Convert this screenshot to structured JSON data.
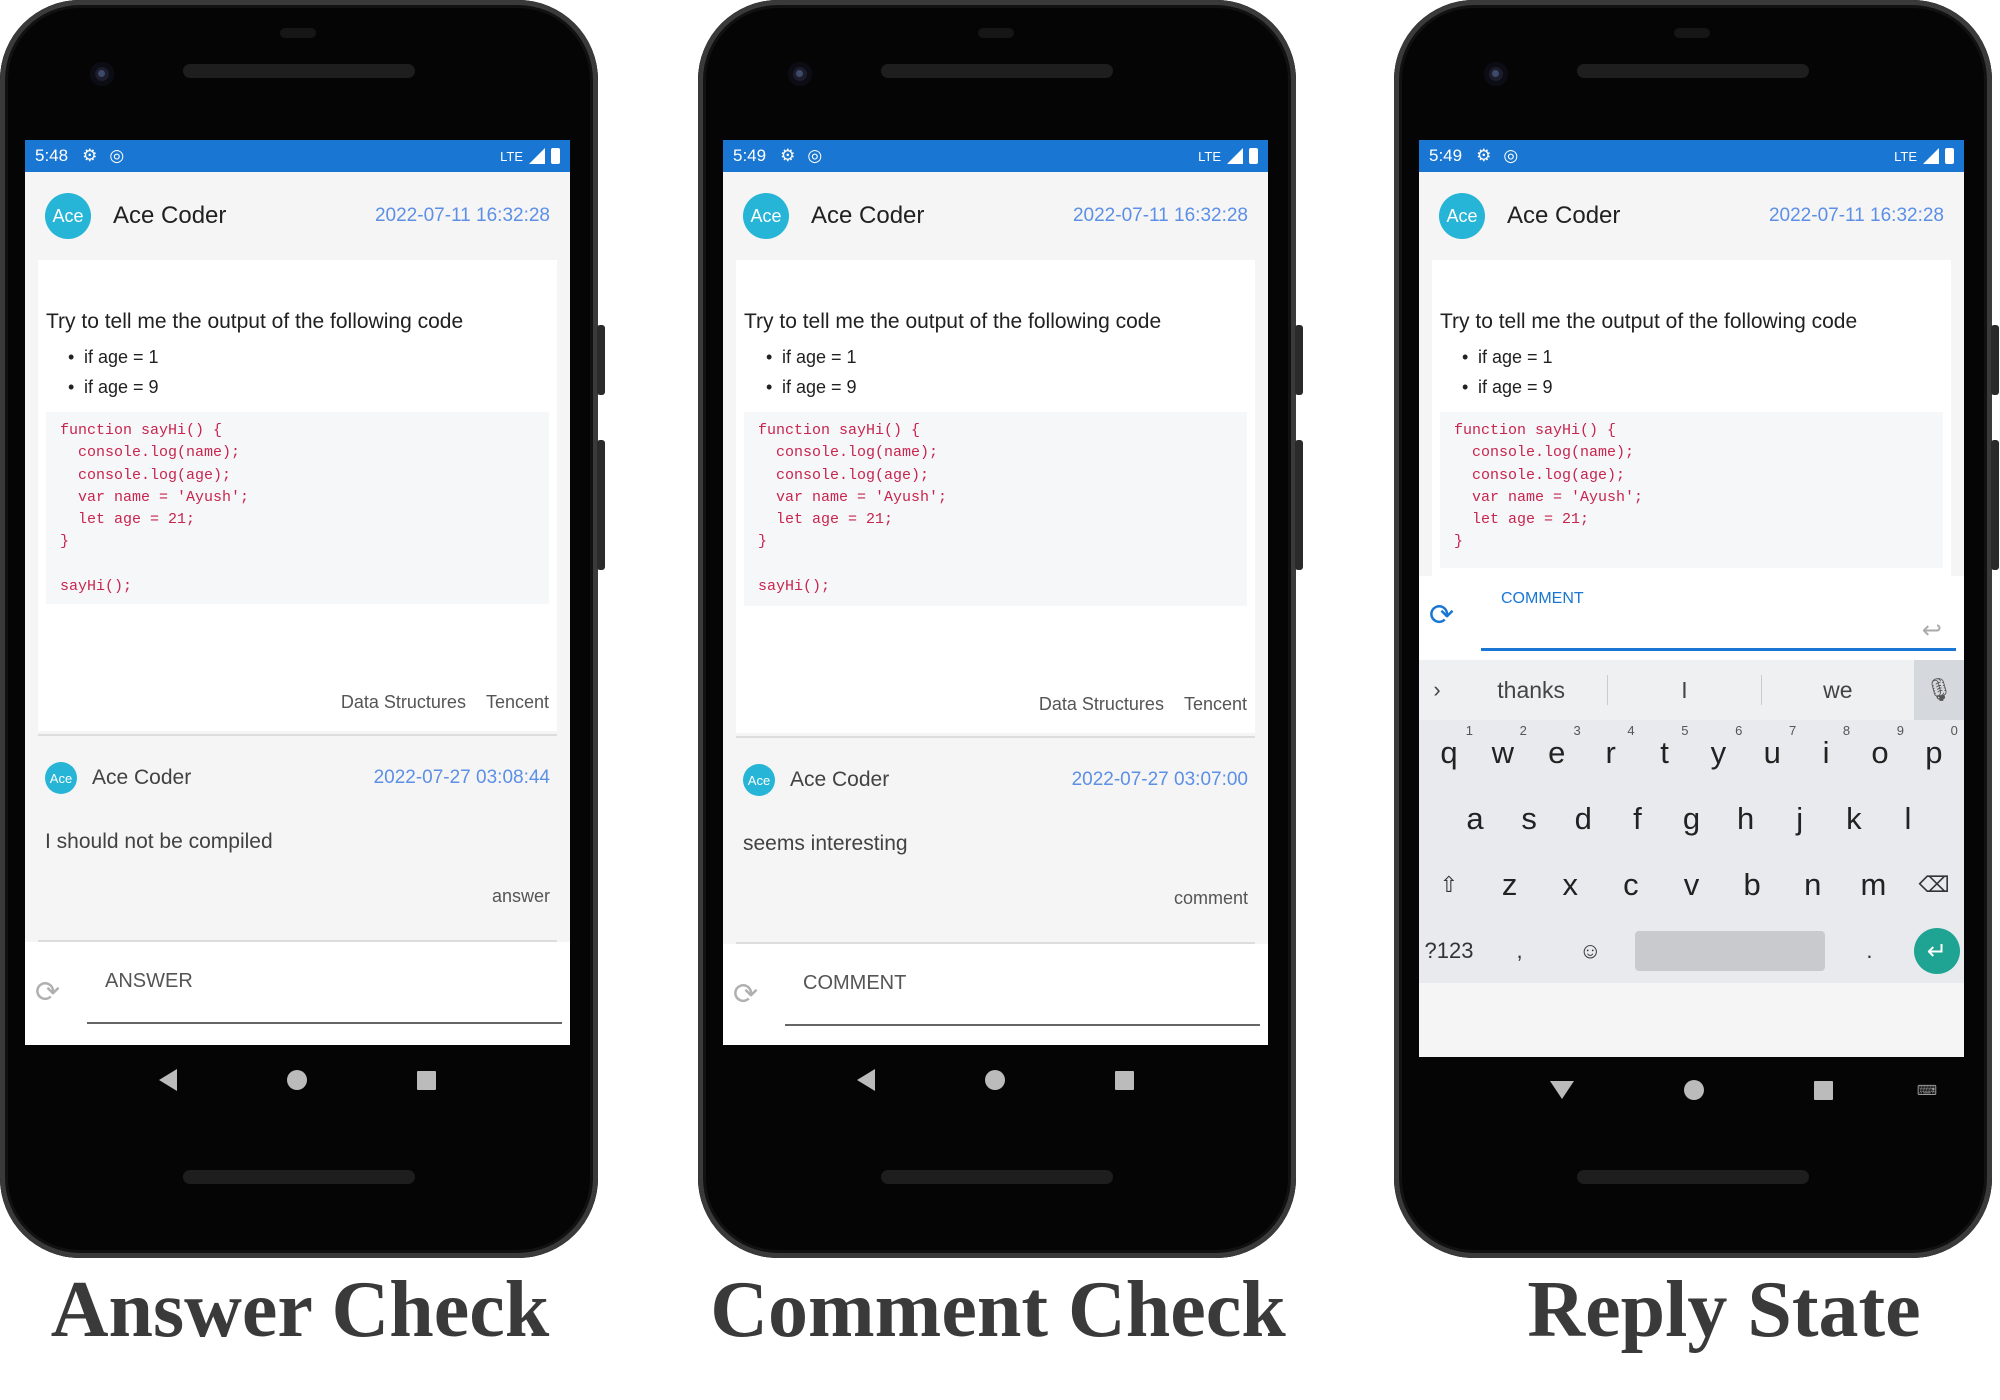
{
  "panels": [
    {
      "status": {
        "time": "5:48",
        "network": "LTE"
      },
      "post": {
        "avatar": "Ace",
        "author": "Ace Coder",
        "date": "2022-07-11 16:32:28",
        "question": "Try to tell me the output of the following code",
        "bullets": [
          "if age = 1",
          "if age = 9"
        ],
        "code": "function sayHi() {\n  console.log(name);\n  console.log(age);\n  var name = 'Ayush';\n  let age = 21;\n}\n\nsayHi();",
        "tags": [
          "Data Structures",
          "Tencent"
        ]
      },
      "reply": {
        "avatar": "Ace",
        "author": "Ace Coder",
        "date": "2022-07-27 03:08:44",
        "text": "I should not be compiled",
        "tag": "answer"
      },
      "input": {
        "label": "ANSWER"
      },
      "caption": "Answer Check"
    },
    {
      "status": {
        "time": "5:49",
        "network": "LTE"
      },
      "post": {
        "avatar": "Ace",
        "author": "Ace Coder",
        "date": "2022-07-11 16:32:28",
        "question": "Try to tell me the output of the following code",
        "bullets": [
          "if age = 1",
          "if age = 9"
        ],
        "code": "function sayHi() {\n  console.log(name);\n  console.log(age);\n  var name = 'Ayush';\n  let age = 21;\n}\n\nsayHi();",
        "tags": [
          "Data Structures",
          "Tencent"
        ]
      },
      "reply": {
        "avatar": "Ace",
        "author": "Ace Coder",
        "date": "2022-07-27 03:07:00",
        "text": "seems interesting",
        "tag": "comment"
      },
      "input": {
        "label": "COMMENT"
      },
      "caption": "Comment Check"
    },
    {
      "status": {
        "time": "5:49",
        "network": "LTE"
      },
      "post": {
        "avatar": "Ace",
        "author": "Ace Coder",
        "date": "2022-07-11 16:32:28",
        "question": "Try to tell me the output of the following code",
        "bullets": [
          "if age = 1",
          "if age = 9"
        ],
        "code": "function sayHi() {\n  console.log(name);\n  console.log(age);\n  var name = 'Ayush';\n  let age = 21;\n}"
      },
      "input": {
        "label": "COMMENT"
      },
      "keyboard": {
        "suggestions": [
          "thanks",
          "I",
          "we"
        ],
        "row1": [
          {
            "k": "q",
            "n": "1"
          },
          {
            "k": "w",
            "n": "2"
          },
          {
            "k": "e",
            "n": "3"
          },
          {
            "k": "r",
            "n": "4"
          },
          {
            "k": "t",
            "n": "5"
          },
          {
            "k": "y",
            "n": "6"
          },
          {
            "k": "u",
            "n": "7"
          },
          {
            "k": "i",
            "n": "8"
          },
          {
            "k": "o",
            "n": "9"
          },
          {
            "k": "p",
            "n": "0"
          }
        ],
        "row2": [
          "a",
          "s",
          "d",
          "f",
          "g",
          "h",
          "j",
          "k",
          "l"
        ],
        "row3": [
          "z",
          "x",
          "c",
          "v",
          "b",
          "n",
          "m"
        ],
        "symbols_key": "?123",
        "comma": ",",
        "period": "."
      },
      "caption": "Reply State"
    }
  ],
  "icons": {
    "settings": "gear-icon",
    "sync": "sync-status-icon",
    "refresh": "refresh-icon",
    "send": "reply-arrow-icon",
    "mic": "microphone-icon",
    "shift": "shift-icon",
    "backspace": "backspace-icon",
    "emoji": "emoji-icon",
    "enter": "enter-icon"
  },
  "colors": {
    "status_bar": "#1976d2",
    "date": "#5c8fe6",
    "avatar": "#26b5d6",
    "code": "#c7254e",
    "enter_key": "#1fa493"
  }
}
